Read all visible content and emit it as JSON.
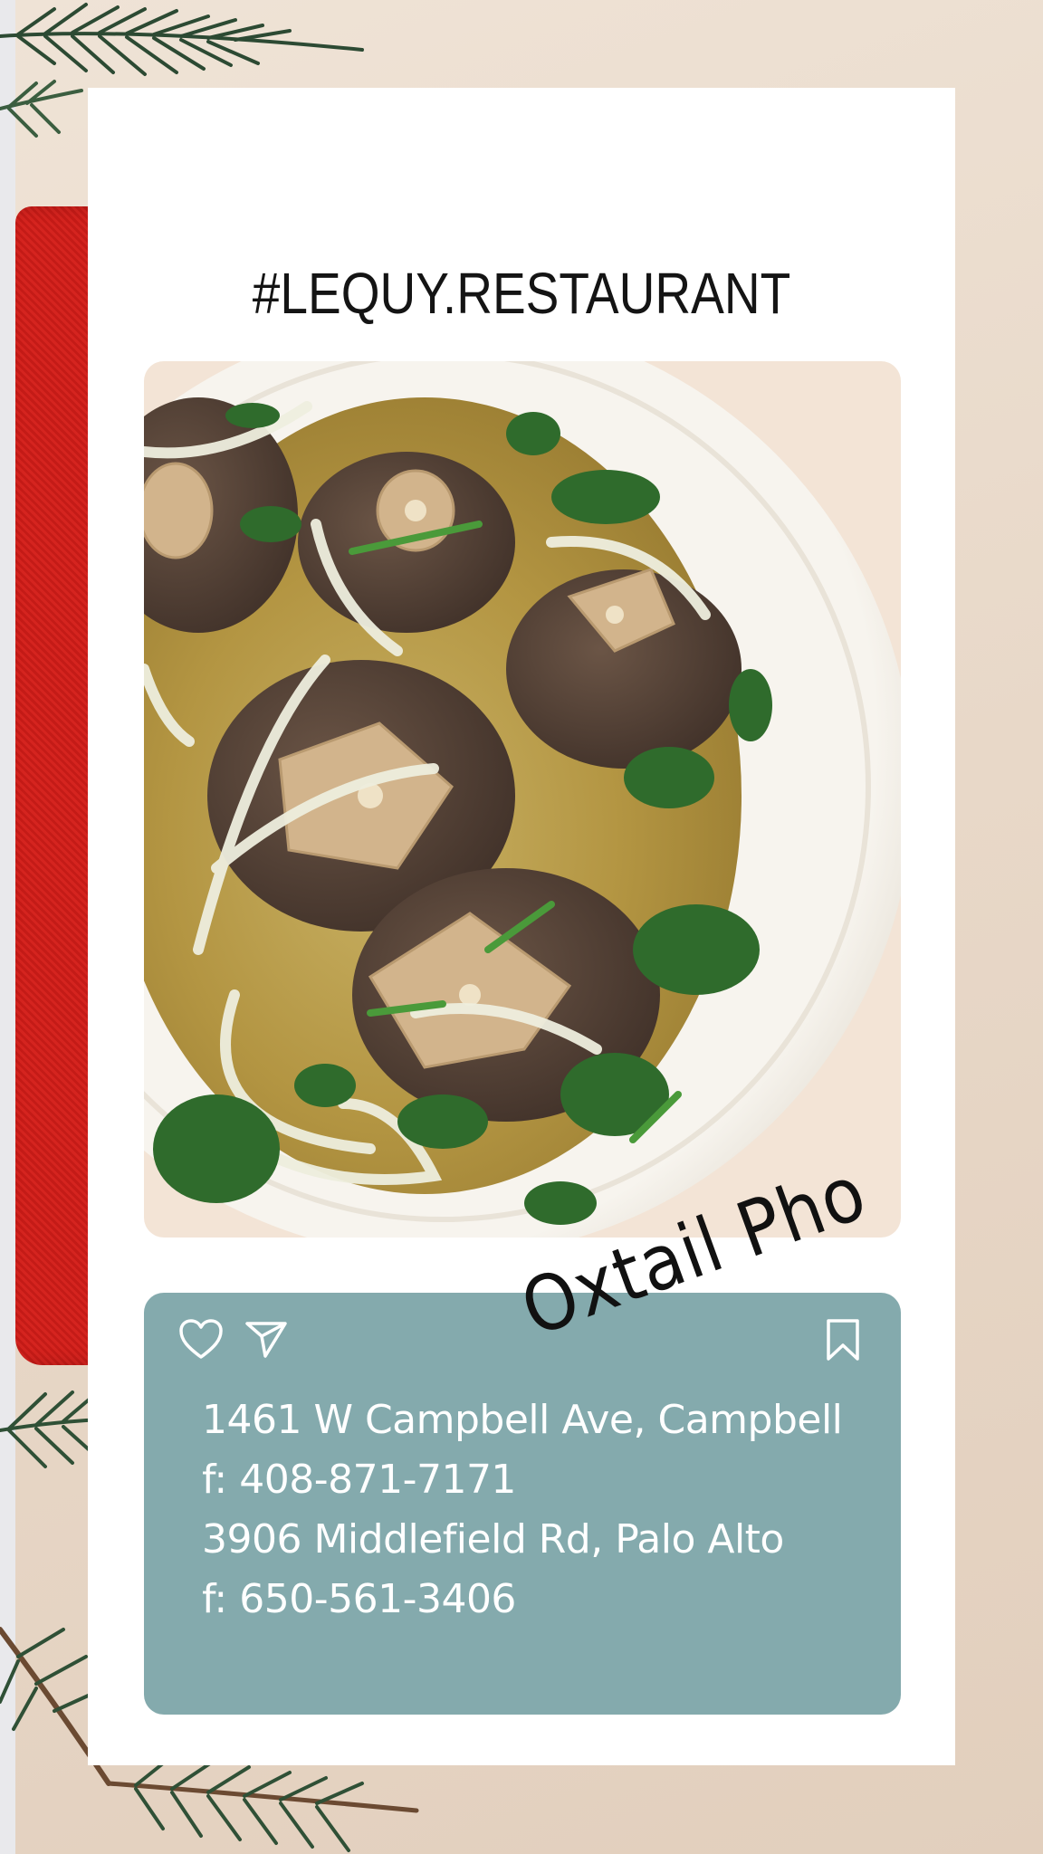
{
  "brand": {
    "title": "#LEQUY.RESTAURANT"
  },
  "post": {
    "dish_name": "Oxtail Pho",
    "photo_alt": "Bowl of oxtail pho with herbs and onions"
  },
  "actions": {
    "like_icon": "heart-icon",
    "share_icon": "send-icon",
    "save_icon": "bookmark-icon"
  },
  "locations": [
    {
      "address": "1461 W Campbell Ave, Campbell",
      "phone": "f: 408-871-7171"
    },
    {
      "address": "3906 Middlefield Rd, Palo Alto",
      "phone": "f: 650-561-3406"
    }
  ],
  "colors": {
    "card_background": "#ffffff",
    "info_panel": "#84aaad",
    "info_text": "#ffffff",
    "title_text": "#141414"
  }
}
